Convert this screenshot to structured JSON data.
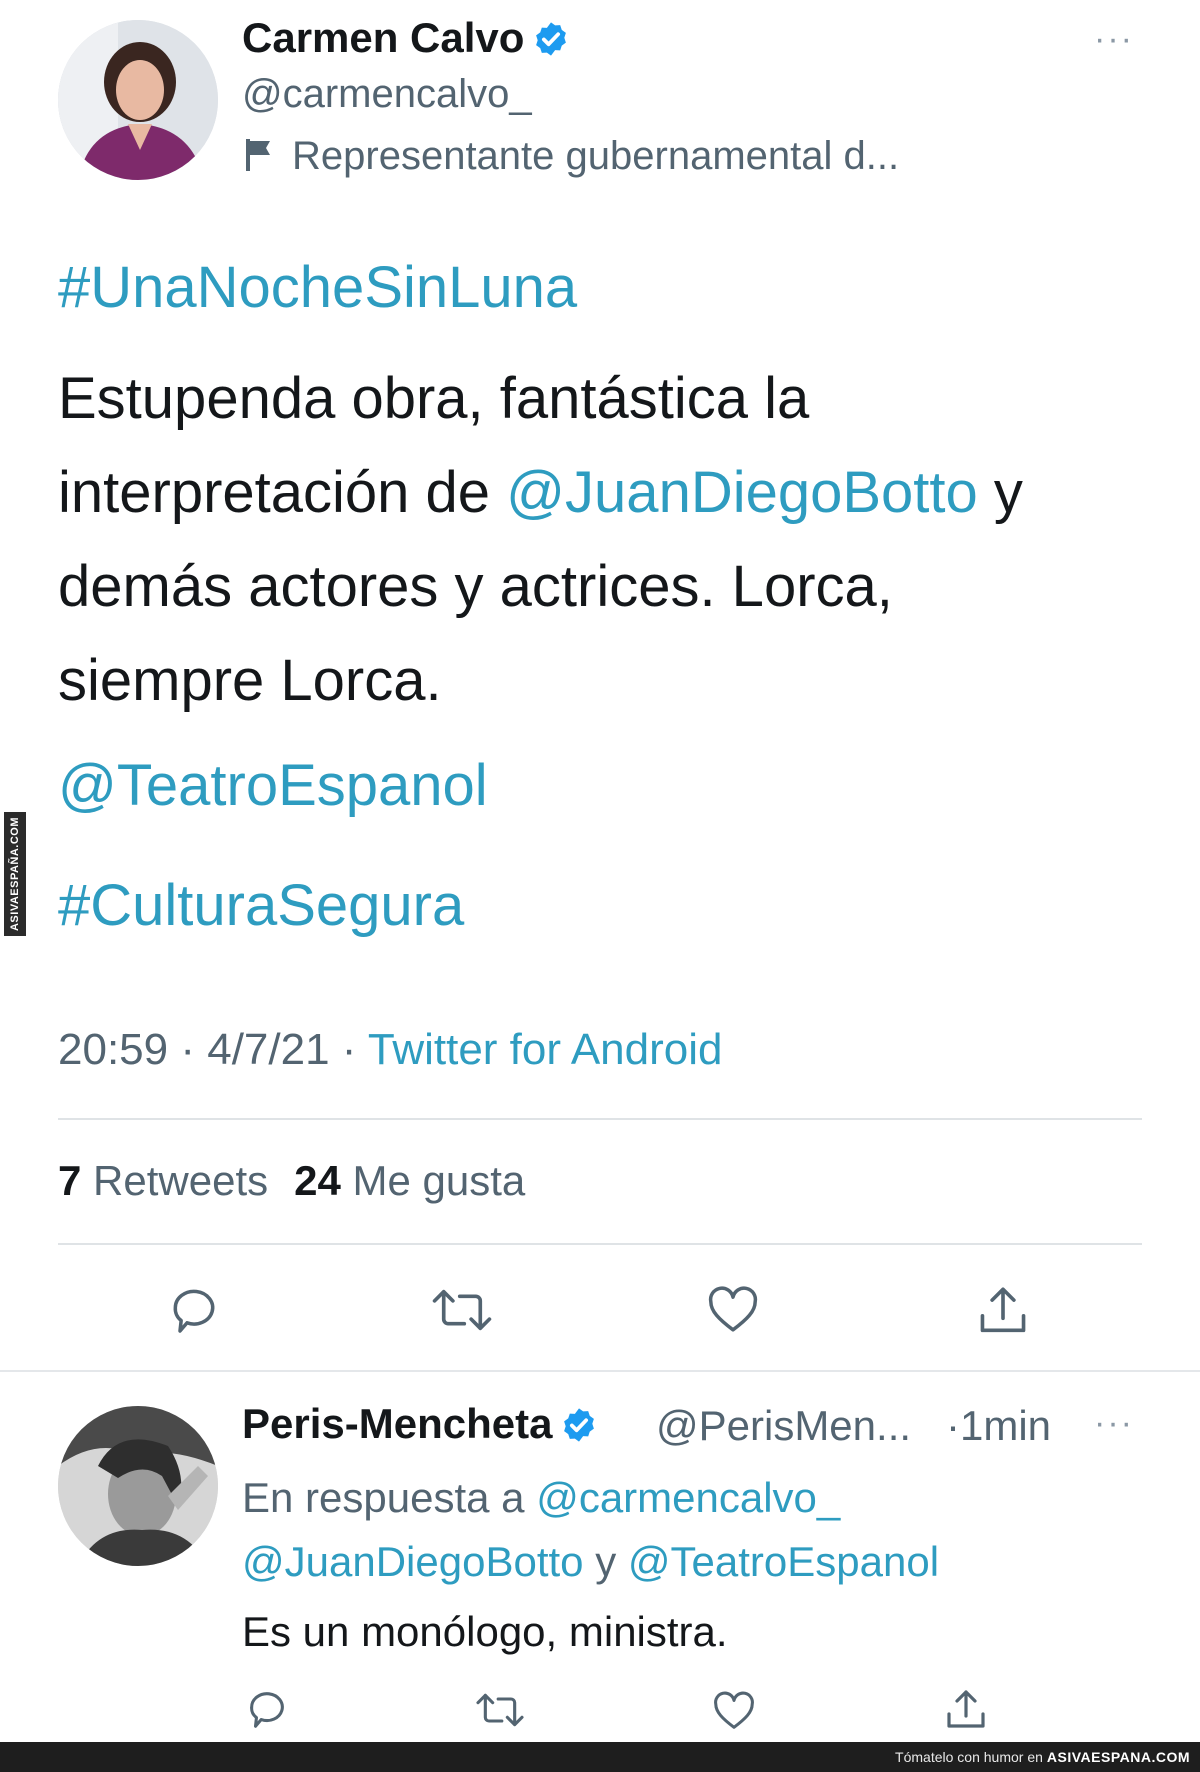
{
  "watermark_side": "ASIVAESPAÑA.COM",
  "tweet": {
    "author_name": "Carmen Calvo",
    "author_handle": "@carmencalvo_",
    "author_label": "Representante gubernamental d...",
    "hashtag_top": "#UnaNocheSinLuna",
    "body_line1": "Estupenda obra, fantástica la",
    "body_line2_a": "interpretación de ",
    "body_line2_mention": "@JuanDiegoBotto",
    "body_line2_b": " y",
    "body_line3": "demás actores y actrices. Lorca,",
    "body_line4": "siempre Lorca.",
    "mention_teatro": "@TeatroEspanol",
    "hashtag_bottom": "#CulturaSegura",
    "time": "20:59",
    "date": "4/7/21",
    "source": "Twitter for Android",
    "retweets_count": "7",
    "retweets_label": "Retweets",
    "likes_count": "24",
    "likes_label": "Me gusta",
    "more": "···"
  },
  "reply": {
    "author_name": "Peris-Mencheta",
    "author_handle": "@PerisMen...",
    "time": "·1min",
    "more": "···",
    "replying_prefix": "En respuesta a ",
    "replying_to_1": "@carmencalvo_",
    "replying_to_2": "@JuanDiegoBotto",
    "replying_and": " y ",
    "replying_to_3": "@TeatroEspanol",
    "text": "Es un monólogo, ministra."
  },
  "footer": {
    "text": "Tómatelo con humor en",
    "brand": "ASIVAESPANA.COM"
  },
  "colors": {
    "link": "#2e9cc0",
    "verified": "#1d9bf0",
    "muted": "#536471"
  },
  "icons": [
    "verified-badge-icon",
    "flag-icon",
    "reply-icon",
    "retweet-icon",
    "like-icon",
    "share-icon",
    "more-icon"
  ]
}
